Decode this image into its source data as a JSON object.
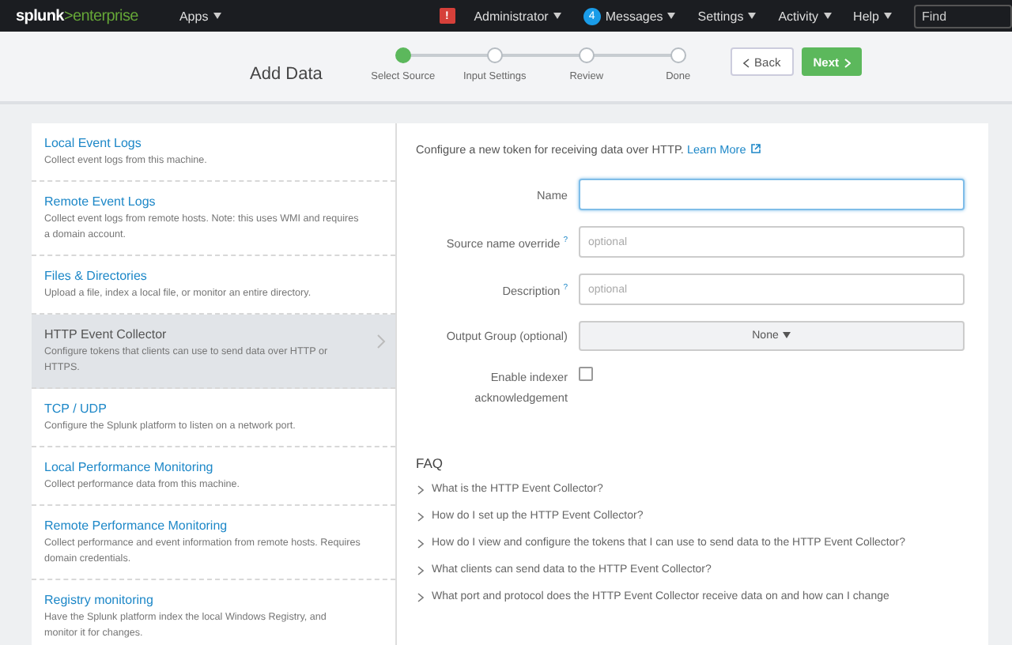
{
  "top_bar": {
    "logo": {
      "brand": "splunk",
      "product": ">enterprise"
    },
    "apps_menu": "Apps",
    "alert_badge": "!",
    "user_menu": "Administrator",
    "messages_count": "4",
    "messages_menu": "Messages",
    "settings_menu": "Settings",
    "activity_menu": "Activity",
    "help_menu": "Help",
    "find": {
      "placeholder": "Find"
    }
  },
  "wizard": {
    "title": "Add Data",
    "steps": [
      {
        "label": "Select Source",
        "selected": true
      },
      {
        "label": "Input Settings",
        "selected": false
      },
      {
        "label": "Review",
        "selected": false
      },
      {
        "label": "Done",
        "selected": false
      }
    ],
    "back_button": "Back",
    "next_button": "Next"
  },
  "sources": [
    {
      "title": "Local Event Logs",
      "description": "Collect event logs from this machine.",
      "selected": false
    },
    {
      "title": "Remote Event Logs",
      "description": "Collect event logs from remote hosts. Note: this uses WMI and requires a domain account.",
      "selected": false
    },
    {
      "title": "Files & Directories",
      "description": "Upload a file, index a local file, or monitor an entire directory.",
      "selected": false
    },
    {
      "title": "HTTP Event Collector",
      "description": "Configure tokens that clients can use to send data over HTTP or HTTPS.",
      "selected": true
    },
    {
      "title": "TCP / UDP",
      "description": "Configure the Splunk platform to listen on a network port.",
      "selected": false
    },
    {
      "title": "Local Performance Monitoring",
      "description": "Collect performance data from this machine.",
      "selected": false
    },
    {
      "title": "Remote Performance Monitoring",
      "description": "Collect performance and event information from remote hosts. Requires domain credentials.",
      "selected": false
    },
    {
      "title": "Registry monitoring",
      "description": "Have the Splunk platform index the local Windows Registry, and monitor it for changes.",
      "selected": false
    }
  ],
  "form": {
    "intro": "Configure a new token for receiving data over HTTP.",
    "learn_more": "Learn More",
    "fields": [
      {
        "kind": "text",
        "label": "Name",
        "focused": true
      },
      {
        "kind": "text",
        "label": "Source name override",
        "help": "?",
        "placeholder": "optional",
        "focused": false
      },
      {
        "kind": "text",
        "label": "Description",
        "help": "?",
        "placeholder": "optional",
        "focused": false
      },
      {
        "kind": "select",
        "label": "Output Group (optional)",
        "value": "None"
      },
      {
        "kind": "checkbox",
        "label": "Enable indexer acknowledgement",
        "checked": false
      }
    ]
  },
  "faq": {
    "title": "FAQ",
    "items": [
      "What is the HTTP Event Collector?",
      "How do I set up the HTTP Event Collector?",
      "How do I view and configure the tokens that I can use to send data to the HTTP Event Collector?",
      "What clients can send data to the HTTP Event Collector?",
      "What port and protocol does the HTTP Event Collector receive data on and how can I change"
    ]
  }
}
